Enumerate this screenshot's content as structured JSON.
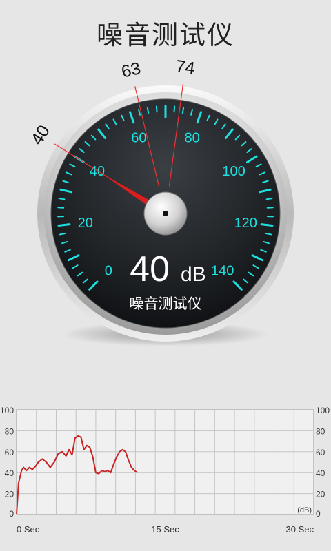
{
  "app": {
    "title": "噪音测试仪"
  },
  "gauge": {
    "value": 40,
    "value_text": "40",
    "unit": "dB",
    "label": "噪音测试仪",
    "scale_min": 0,
    "scale_max": 140,
    "scale_labels": [
      "0",
      "20",
      "40",
      "60",
      "80",
      "100",
      "120",
      "140"
    ],
    "markers": [
      {
        "label": "40",
        "value": 40
      },
      {
        "label": "63",
        "value": 63
      },
      {
        "label": "74",
        "value": 74
      }
    ],
    "needle_color": "#d81e1e",
    "tick_color": "#1de0e0",
    "marker_color": "#e33"
  },
  "chart_data": {
    "type": "line",
    "y_ticks_left": [
      "100",
      "80",
      "60",
      "40",
      "20",
      "0"
    ],
    "y_ticks_right": [
      "100",
      "80",
      "60",
      "40",
      "20",
      "0"
    ],
    "x_tick_labels": [
      "0 Sec",
      "15 Sec",
      "30 Sec"
    ],
    "unit_label": "(dB)",
    "xlim": [
      0,
      30
    ],
    "ylim": [
      0,
      100
    ],
    "grid": true,
    "series": [
      {
        "color": "#c82121",
        "x": [
          0.0,
          0.2,
          0.5,
          0.7,
          1.0,
          1.3,
          1.6,
          1.9,
          2.2,
          2.6,
          3.0,
          3.4,
          3.8,
          4.2,
          4.6,
          5.0,
          5.3,
          5.6,
          5.9,
          6.2,
          6.5,
          6.8,
          7.1,
          7.4,
          7.7,
          8.0,
          8.3,
          8.6,
          8.9,
          9.2,
          9.5,
          9.8,
          10.1,
          10.4,
          10.7,
          11.0,
          11.3,
          11.6,
          11.9,
          12.2
        ],
        "y": [
          0,
          30,
          42,
          45,
          42,
          45,
          43,
          46,
          50,
          53,
          50,
          45,
          50,
          58,
          60,
          56,
          62,
          57,
          73,
          75,
          74,
          62,
          66,
          64,
          55,
          40,
          39,
          42,
          41,
          42,
          40,
          48,
          55,
          60,
          62,
          60,
          52,
          45,
          42,
          40
        ]
      }
    ]
  }
}
